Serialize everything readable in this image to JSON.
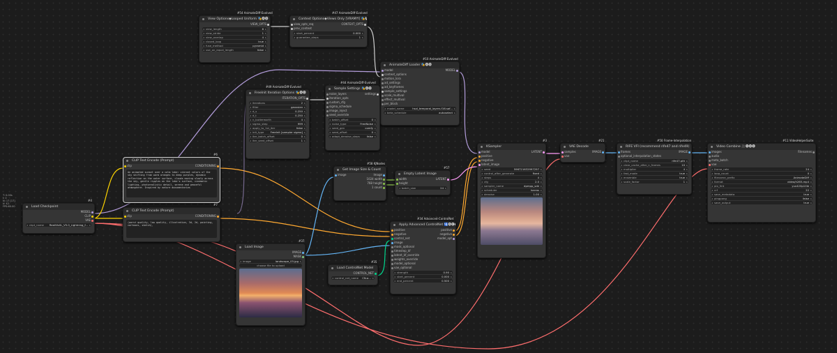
{
  "side_info": [
    "T: 0.00s",
    "I: 0",
    "N: 17 [17]",
    "V: 42",
    "FPS:60.00"
  ],
  "nodes": {
    "view_options": {
      "badge": "#54 AnimateDiff-Evolved",
      "title": "View Options◆Looped Uniform 🎭🅐🅓",
      "out": "VIEW_OPTS",
      "widgets": [
        {
          "label": "view_length",
          "value": "8"
        },
        {
          "label": "view_stride",
          "value": "1"
        },
        {
          "label": "view_overlap",
          "value": "4"
        },
        {
          "label": "closed_loop",
          "value": "true"
        },
        {
          "label": "fuse_method",
          "value": "pyramid"
        },
        {
          "label": "use_on_equal_length",
          "value": "false"
        }
      ]
    },
    "context_options": {
      "badge": "#47 AnimateDiff-Evolved",
      "title": "Context Options◆Views Only [VRAM⇈] 🎭🅐🅓",
      "inputs": [
        "view_opts_req",
        "prev_context"
      ],
      "out": "CONTEXT_OPTS",
      "widgets": [
        {
          "label": "start_percent",
          "value": "0.000"
        },
        {
          "label": "guarantee_steps",
          "value": "1"
        }
      ]
    },
    "animatediff_loader": {
      "badge": "#10 AnimateDiff-Evolved",
      "title": "AnimateDiff Loader 🎭🅐🅓",
      "inputs": [
        "model",
        "context_options",
        "motion_lora",
        "ad_settings",
        "ad_keyframes",
        "sample_settings",
        "scale_multival",
        "effect_multival",
        "per_block"
      ],
      "out": "MODEL",
      "widgets": [
        {
          "label": "model_name",
          "value": "hsxl_temporal_layers.f16.saf..."
        },
        {
          "label": "beta_schedule",
          "value": "autoselect"
        }
      ]
    },
    "freeinit": {
      "badge": "#49 AnimateDiff-Evolved",
      "title": "FreeInit Iteration Options 🎭🅐🅓",
      "out": "ITERATION_OPTS",
      "widgets": [
        {
          "label": "iterations",
          "value": "2"
        },
        {
          "label": "filter",
          "value": "gaussian"
        },
        {
          "label": "d_s",
          "value": "0.250"
        },
        {
          "label": "d_t",
          "value": "0.250"
        },
        {
          "label": "n_butterworth",
          "value": "4"
        },
        {
          "label": "sigma_step",
          "value": "999"
        },
        {
          "label": "apply_to_1st_iter",
          "value": "false"
        },
        {
          "label": "init_type",
          "value": "FreeInit [sampler sigma]"
        },
        {
          "label": "iter_batch_offset",
          "value": "0"
        },
        {
          "label": "iter_seed_offset",
          "value": "1"
        }
      ]
    },
    "sample_settings": {
      "badge": "#44 AnimateDiff-Evolved",
      "title": "Sample Settings 🎭🅐🅓",
      "inputs": [
        "noise_layers",
        "iteration_opts",
        "custom_cfg",
        "sigma_schedule",
        "image_inject",
        "seed_override"
      ],
      "out": "settings",
      "widgets": [
        {
          "label": "batch_offset",
          "value": "0"
        },
        {
          "label": "noise_type",
          "value": "FreeNoise"
        },
        {
          "label": "seed_gen",
          "value": "comfy"
        },
        {
          "label": "seed_offset",
          "value": "0"
        },
        {
          "label": "adapt_denoise_steps",
          "value": "false"
        }
      ]
    },
    "clip_pos": {
      "badge": "#6",
      "title": "CLIP Text Encode (Prompt)",
      "in": "clip",
      "out": "CONDITIONING",
      "text": "An animated sunset over a calm lake: vibrant colors of the sky shifting from warm oranges to deep purples, dynamic reflection on the water surface, clouds moving slowly across the sky, gentle ripples on the lake's surface, cinematic lighting, photorealistic detail, serene and peaceful atmosphere. Inspired by nature documentaries"
    },
    "clip_neg": {
      "badge": "#7",
      "title": "CLIP Text Encode (Prompt)",
      "in": "clip",
      "out": "CONDITIONING",
      "text": "(worst quality, low quality, illustration, 3d, 2d, painting, cartoons, sketch),"
    },
    "checkpoint": {
      "badge": "#4",
      "title": "Load Checkpoint",
      "outs": [
        "MODEL",
        "CLIP",
        "VAE"
      ],
      "widgets": [
        {
          "label": "ckpt_name",
          "value": "RealVisXL_V5.0_Lightning_f..."
        }
      ]
    },
    "load_image": {
      "badge": "#37",
      "title": "Load Image",
      "outs": [
        "IMAGE",
        "MASK"
      ],
      "widgets": [
        {
          "label": "image",
          "value": "landscape_03.jpg"
        }
      ],
      "upload": "choose file to upload"
    },
    "get_size": {
      "badge": "#58 KJNodes",
      "title": "Get Image Size & Count",
      "in": "image",
      "outs": [
        {
          "label": "Image"
        },
        {
          "label": "1024 width"
        },
        {
          "label": "768 height"
        },
        {
          "label": "1 count"
        }
      ]
    },
    "empty_latent": {
      "badge": "#57",
      "title": "Empty Latent Image",
      "inputs": [
        "width",
        "height"
      ],
      "out": "LATENT",
      "widgets": [
        {
          "label": "batch_size",
          "value": "24"
        }
      ]
    },
    "ksampler": {
      "badge": "#3",
      "title": "KSampler",
      "inputs": [
        "model",
        "positive",
        "negative",
        "latent_image"
      ],
      "out": "LATENT",
      "widgets": [
        {
          "label": "seed",
          "value": "596721632997297"
        },
        {
          "label": "control_after_generate",
          "value": "fixed"
        },
        {
          "label": "steps",
          "value": "4"
        },
        {
          "label": "cfg",
          "value": "2.0"
        },
        {
          "label": "sampler_name",
          "value": "dpmpp_sde"
        },
        {
          "label": "scheduler",
          "value": "karras"
        },
        {
          "label": "denoise",
          "value": "1.00"
        }
      ]
    },
    "apply_controlnet": {
      "badge": "#34 Advanced-ControlNet",
      "title": "Apply Advanced ControlNet 🛂🅐🅒🅝",
      "inputs": [
        "positive",
        "negative",
        "control_net",
        "image",
        "mask_optional",
        "timestep_kf",
        "latent_kf_override",
        "weights_override",
        "model_optional",
        "vae_optional"
      ],
      "outs": [
        "positive",
        "negative",
        "model_opt"
      ],
      "widgets": [
        {
          "label": "strength",
          "value": "0.90"
        },
        {
          "label": "start_percent",
          "value": "0.000"
        },
        {
          "label": "end_percent",
          "value": "0.500"
        }
      ]
    },
    "load_controlnet": {
      "badge": "#35",
      "title": "Load ControlNet Model",
      "out": "CONTROL_NET",
      "widgets": [
        {
          "label": "control_net_name",
          "value": "CN-a..."
        }
      ]
    },
    "vae_decode": {
      "badge": "#21",
      "title": "VAE Decode",
      "inputs": [
        "samples",
        "vae"
      ],
      "out": "IMAGE"
    },
    "rife": {
      "badge": "#50 Frame-Interpolation",
      "title": "RIFE VFI (recommend rife47 and rife49)",
      "inputs": [
        "frames",
        "optional_interpolation_states"
      ],
      "out": "IMAGE",
      "widgets": [
        {
          "label": "ckpt_name",
          "value": "rife47.pth"
        },
        {
          "label": "clear_cache_after_n_frames",
          "value": "10"
        },
        {
          "label": "multiplier",
          "value": "4"
        },
        {
          "label": "fast_mode",
          "value": "true"
        },
        {
          "label": "ensemble",
          "value": "true"
        },
        {
          "label": "scale_factor",
          "value": "1"
        }
      ]
    },
    "video_combine": {
      "badge": "#11 VideoHelperSuite",
      "title": "Video Combine 🎥🅥🅗🅢",
      "inputs": [
        "images",
        "audio",
        "meta_batch",
        "vae"
      ],
      "out": "Filenames",
      "widgets": [
        {
          "label": "frame_rate",
          "value": "24"
        },
        {
          "label": "loop_count",
          "value": "0"
        },
        {
          "label": "filename_prefix",
          "value": "AnimateDiff"
        },
        {
          "label": "format",
          "value": "video/h265-mp4"
        },
        {
          "label": "pix_fmt",
          "value": "yuv420p10le"
        },
        {
          "label": "crf",
          "value": "22"
        },
        {
          "label": "save_metadata",
          "value": "true"
        },
        {
          "label": "pingpong",
          "value": "false"
        },
        {
          "label": "save_output",
          "value": "true"
        }
      ]
    }
  },
  "colors": {
    "model": "#b39ddb",
    "clip": "#ffd500",
    "vae": "#ff6e6e",
    "conditioning": "#ffa931",
    "latent": "#ff9cf9",
    "image": "#64b5f6",
    "control_net": "#00d78d",
    "context": "#cfcfcf",
    "int": "#8bc34a"
  }
}
